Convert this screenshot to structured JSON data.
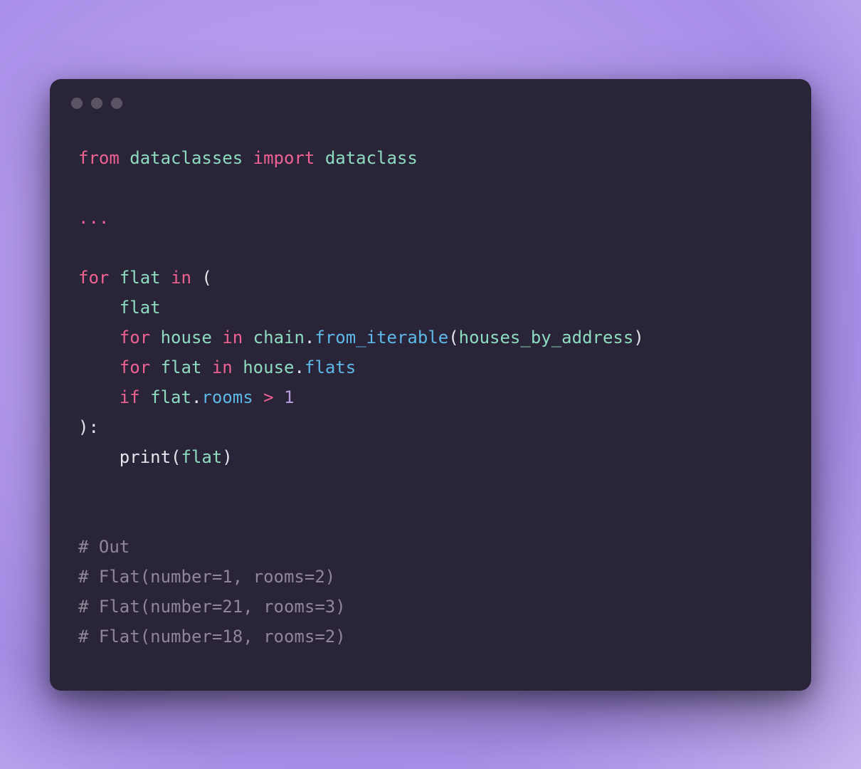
{
  "colors": {
    "keyword": "#f06292",
    "identifier": "#8edcc0",
    "function": "#5cb8e7",
    "punctuation": "#e8e6ef",
    "number": "#b39ddb",
    "comment": "#8d8798",
    "background": "#2a2438"
  },
  "code": {
    "line1": {
      "from": "from",
      "module": "dataclasses",
      "import": "import",
      "name": "dataclass"
    },
    "line3": {
      "ellipsis": "..."
    },
    "line5": {
      "for": "for",
      "var": "flat",
      "in": "in",
      "open": "("
    },
    "line6": {
      "indent": "    ",
      "var": "flat"
    },
    "line7": {
      "indent": "    ",
      "for": "for",
      "var": "house",
      "in": "in",
      "obj": "chain",
      "dot": ".",
      "method": "from_iterable",
      "open": "(",
      "arg": "houses_by_address",
      "close": ")"
    },
    "line8": {
      "indent": "    ",
      "for": "for",
      "var": "flat",
      "in": "in",
      "obj": "house",
      "dot": ".",
      "attr": "flats"
    },
    "line9": {
      "indent": "    ",
      "if": "if",
      "var": "flat",
      "dot": ".",
      "attr": "rooms",
      "op": ">",
      "num": "1"
    },
    "line10": {
      "close": "):"
    },
    "line11": {
      "indent": "    ",
      "fn": "print",
      "open": "(",
      "arg": "flat",
      "close": ")"
    },
    "out1": "# Out",
    "out2": "# Flat(number=1, rooms=2)",
    "out3": "# Flat(number=21, rooms=3)",
    "out4": "# Flat(number=18, rooms=2)"
  }
}
